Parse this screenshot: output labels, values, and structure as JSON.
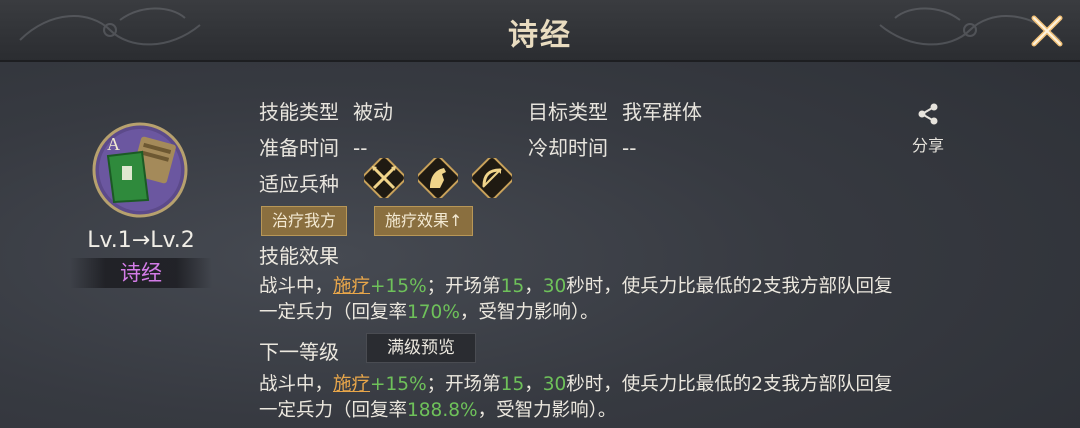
{
  "header": {
    "title": "诗经"
  },
  "skill": {
    "grade": "A",
    "level": "Lv.1→Lv.2",
    "name": "诗经"
  },
  "info": {
    "type_label": "技能类型",
    "type_value": "被动",
    "target_label": "目标类型",
    "target_value": "我军群体",
    "prep_label": "准备时间",
    "prep_value": "--",
    "cooldown_label": "冷却时间",
    "cooldown_value": "--",
    "troop_label": "适应兵种",
    "troops": [
      "spear-icon",
      "cavalry-icon",
      "bow-icon"
    ]
  },
  "tags": [
    "治疗我方",
    "施疗效果↑"
  ],
  "share": {
    "label": "分享"
  },
  "effect": {
    "title": "技能效果",
    "p1": "战斗中，",
    "link": "施疗",
    "p2": "+15%",
    "p3": "；开场第",
    "p4": "15",
    "p5": "，",
    "p6": "30",
    "p7": "秒时，使兵力比最低的2支我方部队回复",
    "p8": "一定兵力（回复率",
    "p9": "170%",
    "p10": "，受智力影响）。"
  },
  "next": {
    "title": "下一等级",
    "button": "满级预览",
    "p1": "战斗中，",
    "link": "施疗",
    "p2": "+15%",
    "p3": "；开场第",
    "p4": "15",
    "p5": "，",
    "p6": "30",
    "p7": "秒时，使兵力比最低的2支我方部队回复",
    "p8": "一定兵力（回复率",
    "p9": "188.8%",
    "p10": "，受智力影响）。"
  },
  "colors": {
    "accent": "#e8a64a",
    "number": "#6ec15a",
    "name": "#d47ce8",
    "tag_bg": "#8a6f3f"
  }
}
